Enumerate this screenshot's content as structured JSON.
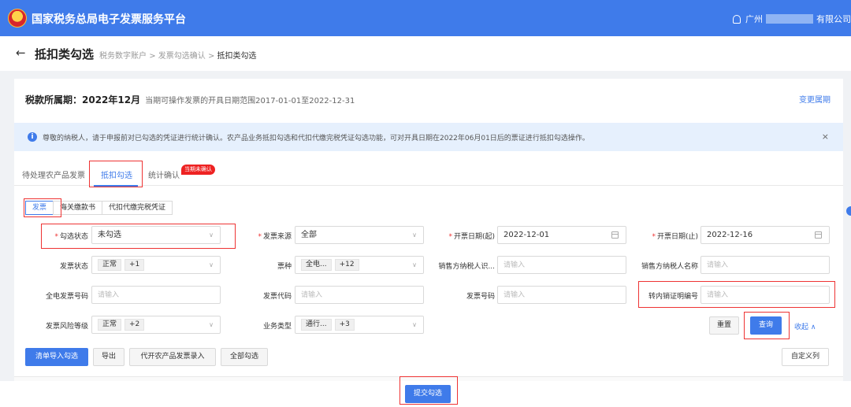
{
  "app": {
    "title": "国家税务总局电子发票服务平台",
    "user_prefix": "广州",
    "user_suffix": "有限公司"
  },
  "page": {
    "title": "抵扣类勾选",
    "breadcrumb": [
      "税务数字账户",
      "发票勾选确认",
      "抵扣类勾选"
    ]
  },
  "period": {
    "label": "税款所属期：2022年12月",
    "note": "当期可操作发票的开具日期范围2017-01-01至2022-12-31",
    "change_link": "变更属期"
  },
  "notice": {
    "text": "尊敬的纳税人，请于申报前对已勾选的凭证进行统计确认。农产品业务抵扣勾选和代扣代缴完税凭证勾选功能，可对开具日期在2022年06月01日后的票证进行抵扣勾选操作。"
  },
  "tabs": [
    {
      "label": "待处理农产品发票"
    },
    {
      "label": "抵扣勾选"
    },
    {
      "label": "统计确认"
    }
  ],
  "tab_badge": "当期未确认",
  "subtabs": [
    {
      "label": "发票"
    },
    {
      "label": "海关缴款书"
    },
    {
      "label": "代扣代缴完税凭证"
    }
  ],
  "filters": {
    "select_status": {
      "label": "勾选状态",
      "value": "未勾选"
    },
    "invoice_source": {
      "label": "发票来源",
      "value": "全部"
    },
    "date_start": {
      "label": "开票日期(起)",
      "value": "2022-12-01"
    },
    "date_end": {
      "label": "开票日期(止)",
      "value": "2022-12-16"
    },
    "invoice_status": {
      "label": "发票状态",
      "tag": "正常",
      "more": "+1"
    },
    "invoice_type": {
      "label": "票种",
      "tag": "全电...",
      "more": "+12"
    },
    "seller_tax_id": {
      "label": "销售方纳税人识...",
      "placeholder": "请输入"
    },
    "seller_name": {
      "label": "销售方纳税人名称",
      "placeholder": "请输入"
    },
    "einvoice_no": {
      "label": "全电发票号码",
      "placeholder": "请输入"
    },
    "invoice_code": {
      "label": "发票代码",
      "placeholder": "请输入"
    },
    "invoice_no": {
      "label": "发票号码",
      "placeholder": "请输入"
    },
    "transfer_cert_no": {
      "label": "转内销证明编号",
      "placeholder": "请输入"
    },
    "risk_level": {
      "label": "发票风险等级",
      "tag": "正常",
      "more": "+2"
    },
    "biz_type": {
      "label": "业务类型",
      "tag": "通行...",
      "more": "+3"
    }
  },
  "buttons": {
    "reset": "重置",
    "query": "查询",
    "collapse": "收起",
    "import_select": "清单导入勾选",
    "export": "导出",
    "agri_entry": "代开农产品发票录入",
    "select_all": "全部勾选",
    "custom_columns": "自定义列",
    "submit": "提交勾选"
  },
  "colors": {
    "primary": "#3f7bea",
    "highlight": "#ee3333"
  }
}
